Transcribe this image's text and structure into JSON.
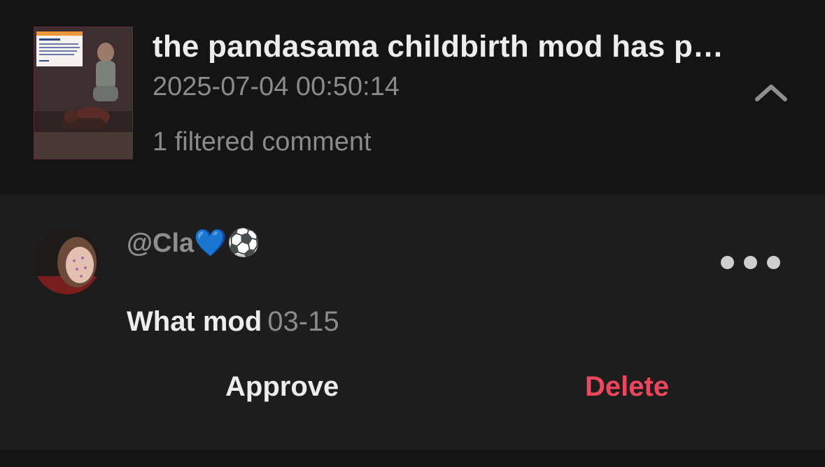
{
  "post": {
    "title": "the pandasama childbirth mod has p…",
    "timestamp": "2025-07-04 00:50:14",
    "filtered_count_text": "1 filtered comment",
    "collapse_icon": "chevron-up-icon"
  },
  "comment": {
    "username": "@Cla💙⚽",
    "text": "What mod",
    "date": "03-15",
    "more_icon": "more-options-icon"
  },
  "actions": {
    "approve_label": "Approve",
    "delete_label": "Delete"
  },
  "colors": {
    "background": "#121212",
    "comment_background": "#1d1d1d",
    "primary_text": "#ededed",
    "secondary_text": "#8b8b8b",
    "delete_red": "#f0465d"
  }
}
